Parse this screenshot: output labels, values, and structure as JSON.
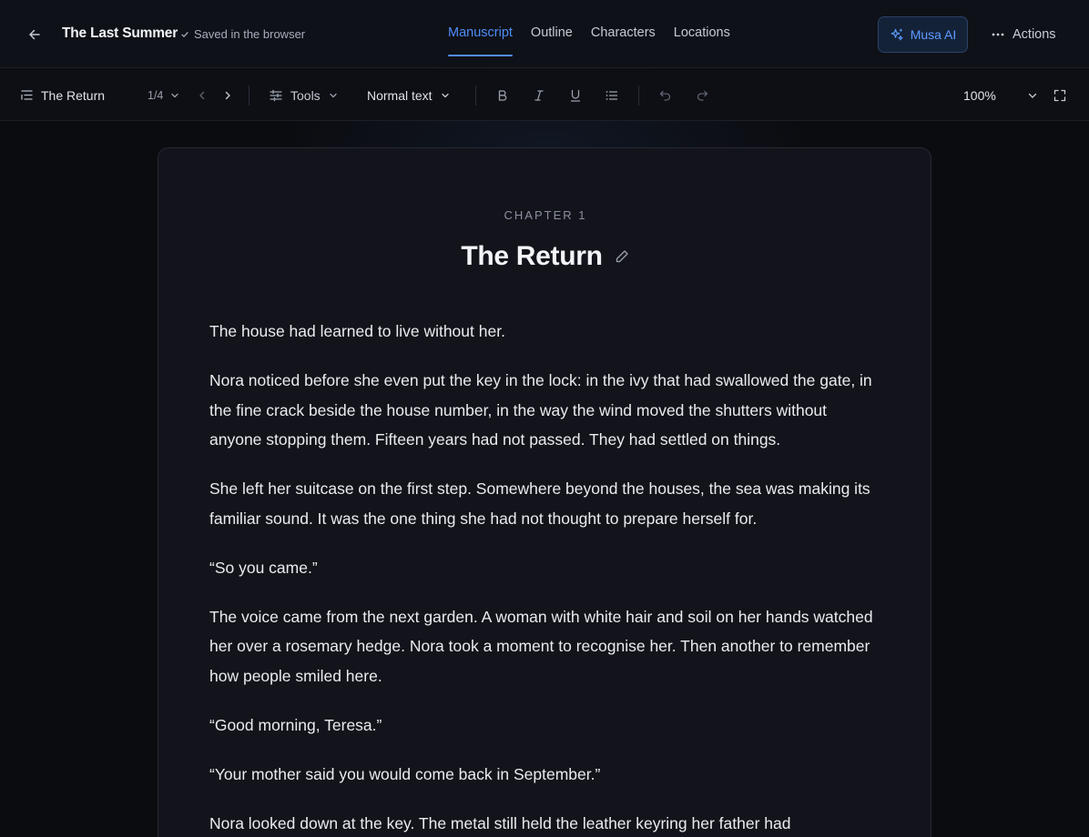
{
  "header": {
    "document_title": "The Last Summer",
    "save_status": "Saved in the browser",
    "tabs": [
      {
        "label": "Manuscript",
        "active": true
      },
      {
        "label": "Outline",
        "active": false
      },
      {
        "label": "Characters",
        "active": false
      },
      {
        "label": "Locations",
        "active": false
      }
    ],
    "ai_button_label": "Musa AI",
    "actions_label": "Actions"
  },
  "toolbar": {
    "chapter_name": "The Return",
    "chapter_position": "1/4",
    "tools_label": "Tools",
    "text_style": "Normal text",
    "zoom": "100%"
  },
  "chapter": {
    "label": "CHAPTER 1",
    "title": "The Return",
    "paragraphs": [
      "The house had learned to live without her.",
      "Nora noticed before she even put the key in the lock: in the ivy that had swallowed the gate, in the fine crack beside the house number, in the way the wind moved the shutters without anyone stopping them. Fifteen years had not passed. They had settled on things.",
      "She left her suitcase on the first step. Somewhere beyond the houses, the sea was making its familiar sound. It was the one thing she had not thought to prepare herself for.",
      "“So you came.”",
      "The voice came from the next garden. A woman with white hair and soil on her hands watched her over a rosemary hedge. Nora took a moment to recognise her. Then another to remember how people smiled here.",
      "“Good morning, Teresa.”",
      "“Your mother said you would come back in September.”",
      "Nora looked down at the key. The metal still held the leather keyring her father had"
    ]
  },
  "colors": {
    "accent": "#4f8df7",
    "background": "#0b0c10",
    "page": "#13141b"
  }
}
